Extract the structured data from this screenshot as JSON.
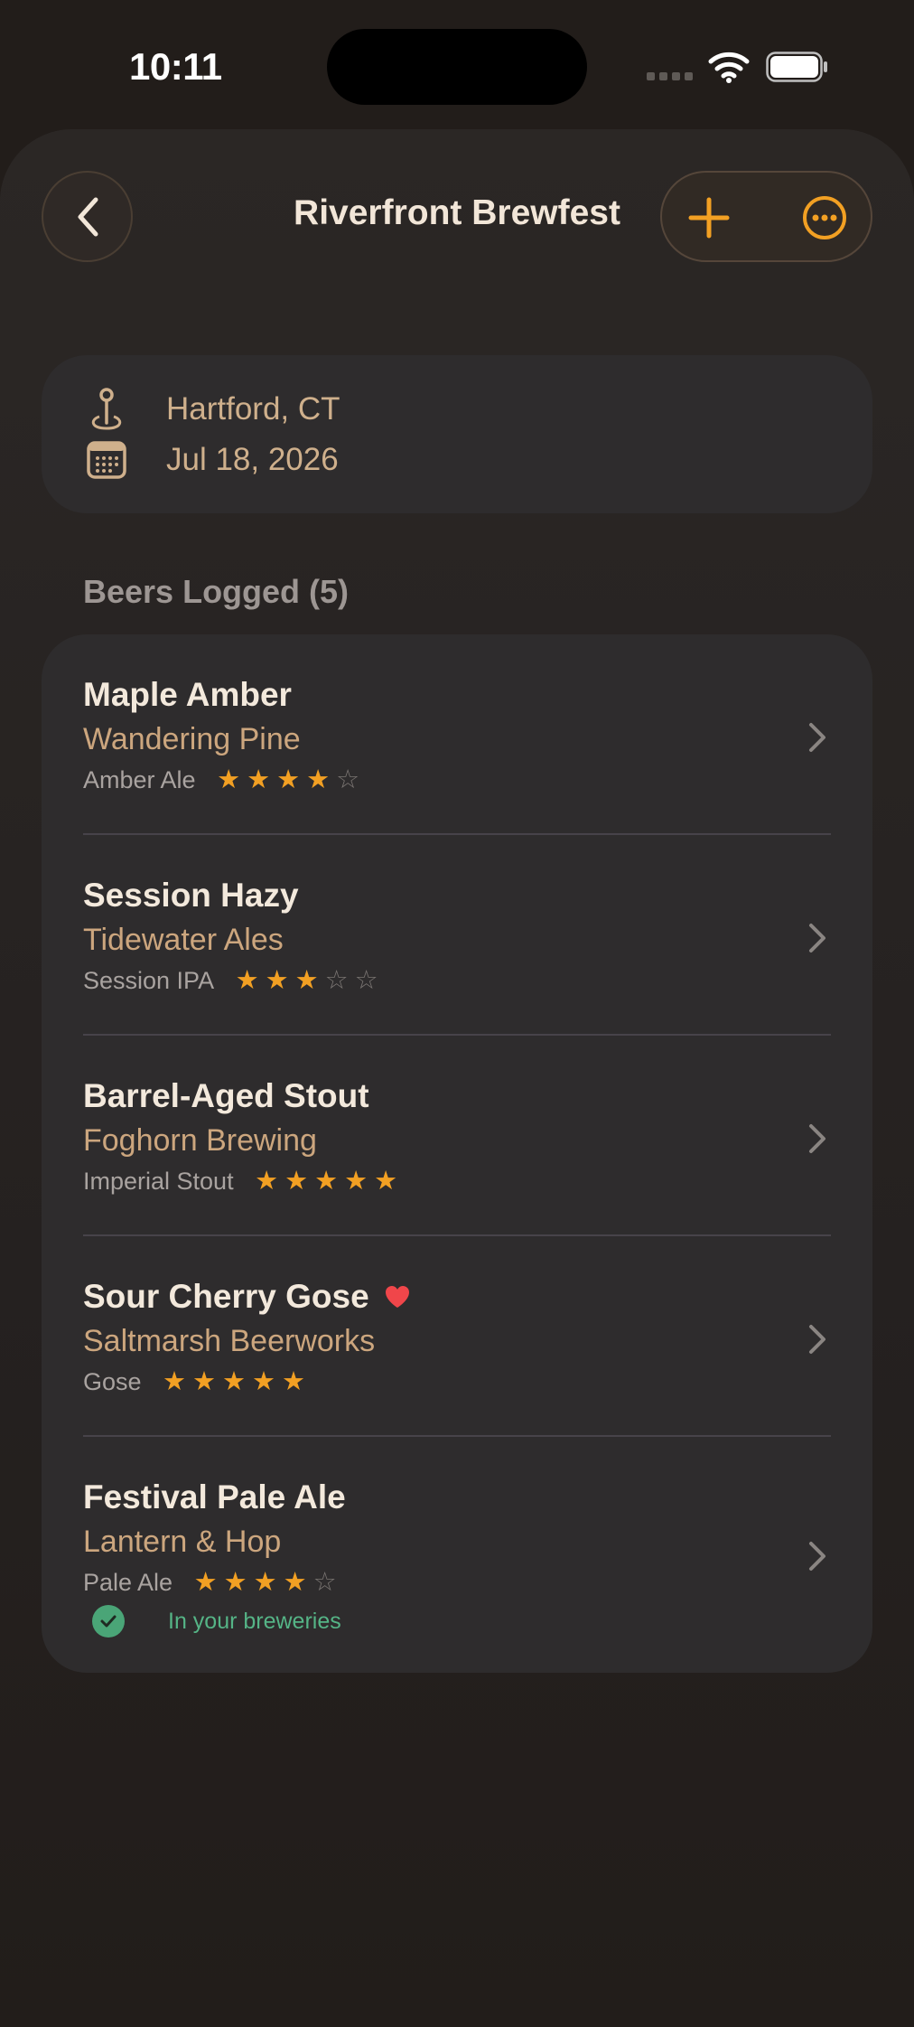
{
  "status_bar": {
    "time": "10:11"
  },
  "nav": {
    "title": "Riverfront Brewfest"
  },
  "event": {
    "location": "Hartford, CT",
    "date": "Jul 18, 2026"
  },
  "section": {
    "header": "Beers Logged (5)"
  },
  "beers": [
    {
      "name": "Maple Amber",
      "brewery": "Wandering Pine",
      "style": "Amber Ale",
      "rating": 4,
      "favorite": false,
      "in_breweries": false
    },
    {
      "name": "Session Hazy",
      "brewery": "Tidewater Ales",
      "style": "Session IPA",
      "rating": 3,
      "favorite": false,
      "in_breweries": false
    },
    {
      "name": "Barrel-Aged Stout",
      "brewery": "Foghorn Brewing",
      "style": "Imperial Stout",
      "rating": 5,
      "favorite": false,
      "in_breweries": false
    },
    {
      "name": "Sour Cherry Gose",
      "brewery": "Saltmarsh Beerworks",
      "style": "Gose",
      "rating": 5,
      "favorite": true,
      "in_breweries": false
    },
    {
      "name": "Festival Pale Ale",
      "brewery": "Lantern & Hop",
      "style": "Pale Ale",
      "rating": 4,
      "favorite": false,
      "in_breweries": true,
      "badge": "In your breweries"
    }
  ],
  "colors": {
    "accent": "#f2a023",
    "brewery_text": "#cca67e",
    "favorite": "#f0464a",
    "success": "#4aa577",
    "card": "#2e2c2d"
  },
  "icons": {
    "back": "chevron-left-icon",
    "add": "plus-icon",
    "more": "ellipsis-circle-icon",
    "location": "pin-icon",
    "date": "calendar-icon",
    "row": "chevron-right-icon",
    "favorite": "heart-icon",
    "badge": "checkmark-circle-icon"
  }
}
